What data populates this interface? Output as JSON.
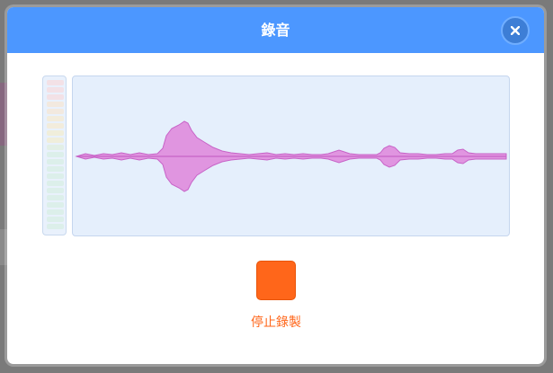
{
  "modal": {
    "title": "錄音",
    "close_label": "close"
  },
  "recorder": {
    "stop_label": "停止錄製"
  },
  "colors": {
    "header": "#4c97ff",
    "stop": "#ff661a",
    "waveform_fill": "#e095e0",
    "waveform_stroke": "#c763c7",
    "panel_bg": "#e5effc"
  },
  "icons": {
    "close": "close-icon"
  }
}
